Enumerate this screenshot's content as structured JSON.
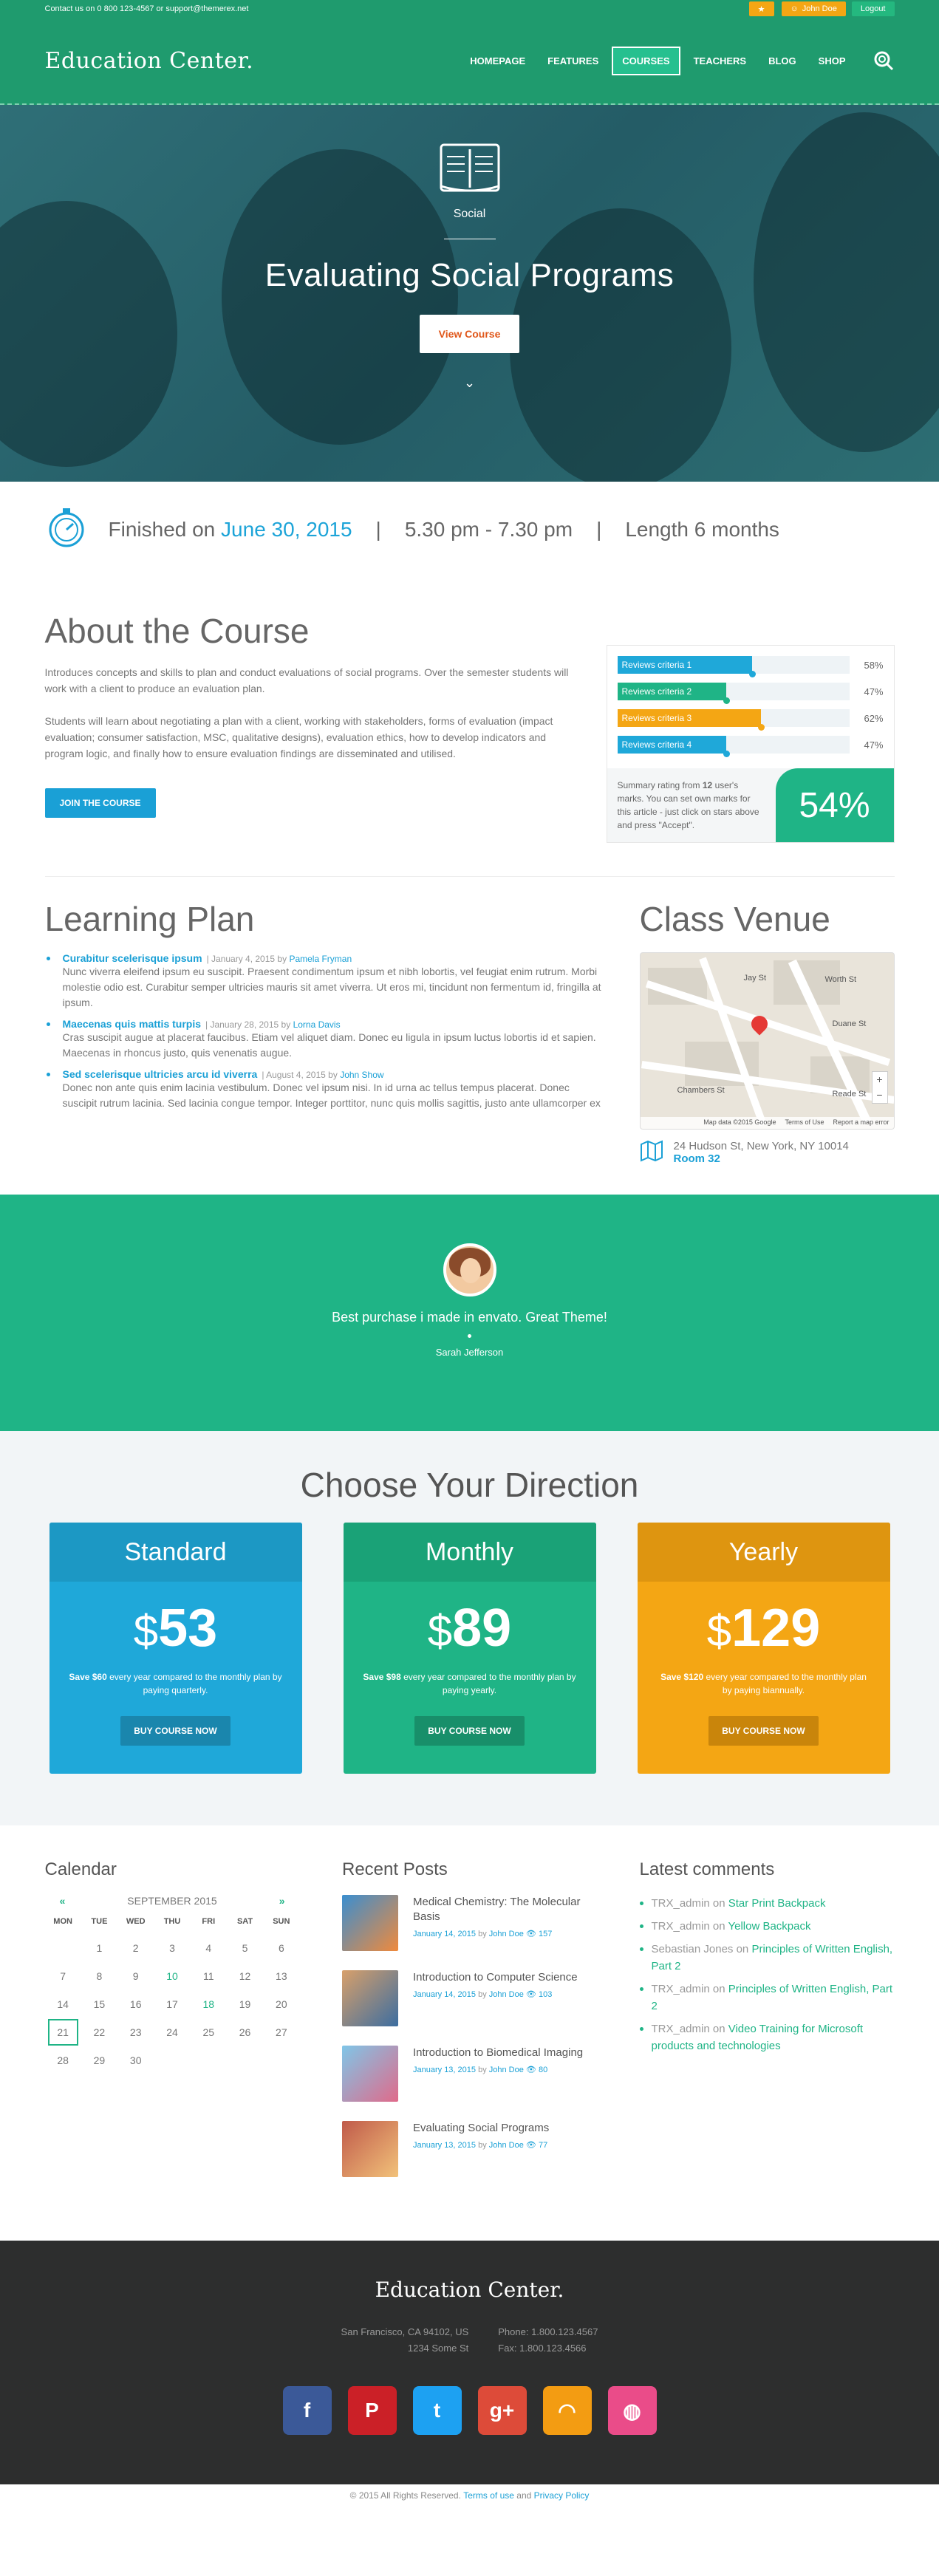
{
  "topbar": {
    "contact": "Contact us on 0 800 123-4567 or support@themerex.net",
    "user": "John Doe",
    "logout": "Logout"
  },
  "header": {
    "logo": "Education Center.",
    "menu": [
      "HOMEPAGE",
      "FEATURES",
      "COURSES",
      "TEACHERS",
      "BLOG",
      "SHOP"
    ],
    "active_index": 2
  },
  "hero": {
    "category": "Social",
    "title": "Evaluating Social Programs",
    "button": "View Course"
  },
  "info": {
    "finished_prefix": "Finished on",
    "date": "June 30, 2015",
    "time": "5.30 pm - 7.30 pm",
    "length": "Length 6 months"
  },
  "about": {
    "title": "About the Course",
    "p1": "Introduces concepts and skills to plan and conduct evaluations of social programs. Over the semester students will work with a client to produce an evaluation plan.",
    "p2": "Students will learn about negotiating a plan with a client, working with stakeholders, forms of evaluation (impact evaluation; consumer satisfaction, MSC, qualitative designs), evaluation ethics, how to develop indicators and program logic, and finally how to ensure evaluation findings are disseminated and utilised.",
    "join": "JOIN THE COURSE"
  },
  "reviews": {
    "criteria": [
      {
        "label": "Reviews criteria 1",
        "value": 58,
        "text": "58%",
        "color": "#1fa8d9"
      },
      {
        "label": "Reviews criteria 2",
        "value": 47,
        "text": "47%",
        "color": "#1fb486"
      },
      {
        "label": "Reviews criteria 3",
        "value": 62,
        "text": "62%",
        "color": "#f4a614"
      },
      {
        "label": "Reviews criteria 4",
        "value": 47,
        "text": "47%",
        "color": "#1fa8d9"
      }
    ],
    "summary_a": "Summary rating from",
    "summary_count": "12",
    "summary_b": "user's marks. You can set own marks for this article - just click on stars above and press \"Accept\".",
    "total": "54%"
  },
  "plan": {
    "title": "Learning Plan",
    "items": [
      {
        "title": "Curabitur scelerisque ipsum",
        "date": "| January 4, 2015 by",
        "author": "Pamela Fryman",
        "text": "Nunc viverra eleifend ipsum eu suscipit. Praesent condimentum ipsum et nibh lobortis, vel feugiat enim rutrum. Morbi molestie odio est. Curabitur semper ultricies mauris sit amet viverra. Ut eros mi, tincidunt non fermentum id, fringilla at ipsum."
      },
      {
        "title": "Maecenas quis mattis turpis",
        "date": "| January 28, 2015 by",
        "author": "Lorna Davis",
        "text": "Cras suscipit augue at placerat faucibus. Etiam vel aliquet diam. Donec eu ligula in ipsum luctus lobortis id et sapien. Maecenas in rhoncus justo, quis venenatis augue."
      },
      {
        "title": "Sed scelerisque ultricies arcu id viverra",
        "date": "| August 4, 2015 by",
        "author": "John Show",
        "text": "Donec non ante quis enim lacinia vestibulum. Donec vel ipsum nisi. In id urna ac tellus tempus placerat. Donec suscipit rutrum lacinia. Sed lacinia congue tempor. Integer porttitor, nunc quis mollis sagittis, justo ante ullamcorper ex"
      }
    ]
  },
  "venue": {
    "title": "Class Venue",
    "address": "24 Hudson St, New York, NY 10014",
    "room": "Room 32",
    "map_labels": [
      "Jay St",
      "Worth St",
      "Duane St",
      "Chambers St",
      "Reade St",
      "Map data ©2015 Google",
      "Terms of Use",
      "Report a map error"
    ]
  },
  "testimonial": {
    "quote": "Best purchase i made in envato. Great Theme!",
    "author": "Sarah Jefferson"
  },
  "pricing": {
    "title": "Choose Your Direction",
    "plans": [
      {
        "name": "Standard",
        "currency": "$",
        "price": "53",
        "save_b": "Save $60",
        "save": "every year compared to the monthly plan by paying quarterly.",
        "button": "BUY COURSE NOW"
      },
      {
        "name": "Monthly",
        "currency": "$",
        "price": "89",
        "save_b": "Save $98",
        "save": "every year compared to the monthly plan by paying yearly.",
        "button": "BUY COURSE NOW"
      },
      {
        "name": "Yearly",
        "currency": "$",
        "price": "129",
        "save_b": "Save $120",
        "save": "every year compared to the monthly plan by paying biannually.",
        "button": "BUY COURSE NOW"
      }
    ],
    "colors": [
      "#1fa8d9",
      "#1fb486",
      "#f4a614"
    ]
  },
  "calendar": {
    "title": "Calendar",
    "prev": "«",
    "month": "SEPTEMBER 2015",
    "next": "»",
    "days": [
      "MON",
      "TUE",
      "WED",
      "THU",
      "FRI",
      "SAT",
      "SUN"
    ],
    "dates": [
      "",
      "1",
      "2",
      "3",
      "4",
      "5",
      "6",
      "7",
      "8",
      "9",
      "10",
      "11",
      "12",
      "13",
      "14",
      "15",
      "16",
      "17",
      "18",
      "19",
      "20",
      "21",
      "22",
      "23",
      "24",
      "25",
      "26",
      "27",
      "28",
      "29",
      "30"
    ],
    "event_dates": [
      "10",
      "18"
    ],
    "today": "21"
  },
  "recent": {
    "title": "Recent Posts",
    "posts": [
      {
        "title": "Medical Chemistry: The Molecular Basis",
        "date": "January 14, 2015",
        "by": "by",
        "author": "John Doe",
        "views": "157"
      },
      {
        "title": "Introduction to Computer Science",
        "date": "January 14, 2015",
        "by": "by",
        "author": "John Doe",
        "views": "103"
      },
      {
        "title": "Introduction to Biomedical Imaging",
        "date": "January 13, 2015",
        "by": "by",
        "author": "John Doe",
        "views": "80"
      },
      {
        "title": "Evaluating Social Programs",
        "date": "January 13, 2015",
        "by": "by",
        "author": "John Doe",
        "views": "77"
      }
    ]
  },
  "comments": {
    "title": "Latest comments",
    "items": [
      {
        "who": "TRX_admin",
        "on": "on",
        "what": "Star Print Backpack"
      },
      {
        "who": "TRX_admin",
        "on": "on",
        "what": "Yellow Backpack"
      },
      {
        "who": "Sebastian Jones",
        "on": "on",
        "what": "Principles of Written English, Part 2"
      },
      {
        "who": "TRX_admin",
        "on": "on",
        "what": "Principles of Written English, Part 2"
      },
      {
        "who": "TRX_admin",
        "on": "on",
        "what": "Video Training for Microsoft products and technologies"
      }
    ]
  },
  "footer": {
    "logo": "Education Center.",
    "addr1": "San Francisco, CA 94102, US",
    "addr2": "1234 Some St",
    "phone": "Phone: 1.800.123.4567",
    "fax": "Fax: 1.800.123.4566",
    "socials": [
      {
        "name": "facebook",
        "glyph": "f",
        "color": "#3b5998"
      },
      {
        "name": "pinterest",
        "glyph": "P",
        "color": "#cb2027"
      },
      {
        "name": "twitter",
        "glyph": "t",
        "color": "#1da1f2"
      },
      {
        "name": "google-plus",
        "glyph": "g+",
        "color": "#dd4b39"
      },
      {
        "name": "rss",
        "glyph": "◠",
        "color": "#f39c12"
      },
      {
        "name": "dribbble",
        "glyph": "◍",
        "color": "#ea4c89"
      }
    ],
    "copyright": "© 2015 All Rights Reserved.",
    "terms": "Terms of use",
    "and": "and",
    "privacy": "Privacy Policy"
  }
}
